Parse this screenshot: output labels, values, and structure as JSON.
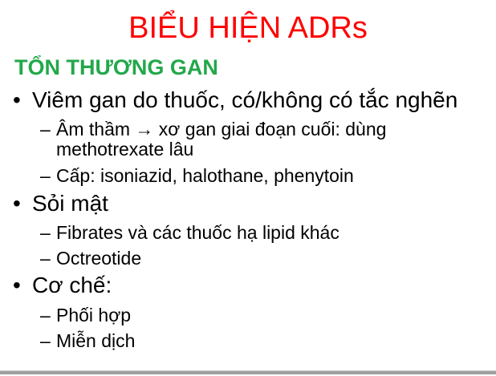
{
  "slide": {
    "title": "BIỂU HIỆN ADRs",
    "heading": "TỔN THƯƠNG GAN",
    "bullet_marker": "•",
    "dash_marker": "–",
    "bullets": [
      {
        "text": "Viêm gan do thuốc, có/không có tắc nghẽn",
        "sub": [
          {
            "line1": "Âm thầm → xơ gan giai đoạn cuối: dùng",
            "line2": "methotrexate lâu"
          },
          {
            "line1": "Cấp: isoniazid, halothane, phenytoin"
          }
        ]
      },
      {
        "text": "Sỏi mật",
        "sub": [
          {
            "line1": "Fibrates và các thuốc hạ lipid khác"
          },
          {
            "line1": "Octreotide"
          }
        ]
      },
      {
        "text": "Cơ chế:",
        "sub": [
          {
            "line1": "Phối hợp"
          },
          {
            "line1": "Miễn dịch"
          }
        ]
      }
    ]
  }
}
